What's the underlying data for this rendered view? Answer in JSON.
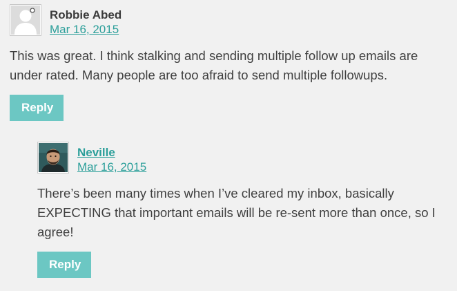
{
  "comments": [
    {
      "author": "Robbie Abed",
      "author_is_link": false,
      "date": "Mar 16, 2015",
      "avatar": "default-user-avatar",
      "text": "This was great. I think stalking and sending multiple follow up emails are under rated. Many people are too afraid to send multiple followups.",
      "reply_label": "Reply"
    },
    {
      "author": "Neville",
      "author_is_link": true,
      "date": "Mar 16, 2015",
      "avatar": "photo-avatar",
      "text": "There’s been many times when I’ve cleared my inbox, basically EXPECTING that important emails will be re-sent more than once, so I agree!",
      "reply_label": "Reply"
    }
  ],
  "colors": {
    "background": "#f1f1f1",
    "link": "#2c9f9a",
    "button": "#6cc7c3",
    "text": "#3f3f3f"
  }
}
